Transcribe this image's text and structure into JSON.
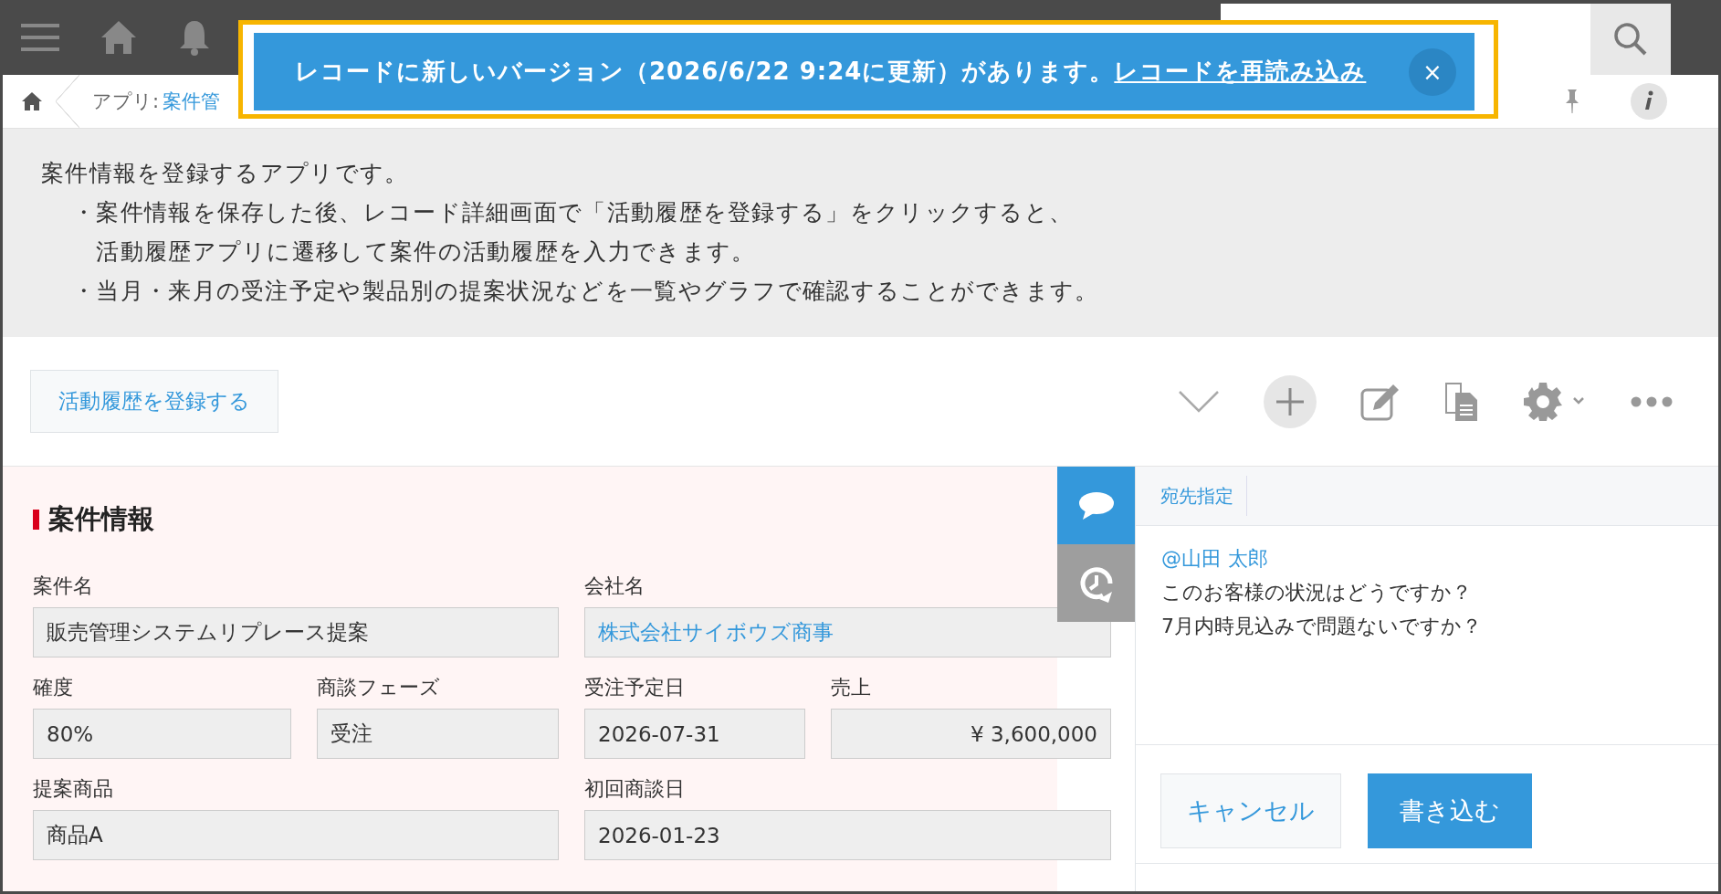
{
  "breadcrumb": {
    "prefix": "アプリ:",
    "app": "案件管"
  },
  "notice": {
    "message": "レコードに新しいバージョン（2026/6/22 9:24に更新）があります。",
    "link": "レコードを再読み込み",
    "close": "×"
  },
  "description": {
    "intro": "案件情報を登録するアプリです。",
    "bullets": [
      {
        "marker": "・",
        "lines": [
          "案件情報を保存した後、レコード詳細画面で「活動履歴を登録する」をクリックすると、",
          "活動履歴アプリに遷移して案件の活動履歴を入力できます。"
        ]
      },
      {
        "marker": "・",
        "lines": [
          "当月・来月の受注予定や製品別の提案状況などを一覧やグラフで確認することができます。"
        ]
      }
    ]
  },
  "actions": {
    "button": "活動履歴を登録する"
  },
  "form": {
    "section_title": "案件情報",
    "fields": [
      {
        "label": "案件名",
        "value": "販売管理システムリプレース提案",
        "kind": "text",
        "wide": true
      },
      {
        "label": "会社名",
        "value": "株式会社サイボウズ商事",
        "kind": "link",
        "wide": true
      },
      {
        "label": "確度",
        "value": "80%",
        "kind": "text",
        "wide": false
      },
      {
        "label": "商談フェーズ",
        "value": "受注",
        "kind": "text",
        "wide": false
      },
      {
        "label": "受注予定日",
        "value": "2026-07-31",
        "kind": "text",
        "wide": false
      },
      {
        "label": "売上",
        "value": "¥ 3,600,000",
        "kind": "currency",
        "wide": false
      },
      {
        "label": "提案商品",
        "value": "商品A",
        "kind": "text",
        "wide": true
      },
      {
        "label": "初回商談日",
        "value": "2026-01-23",
        "kind": "text",
        "wide": true
      }
    ]
  },
  "side_tabs": [
    {
      "kind": "comments",
      "selected": true
    },
    {
      "kind": "history",
      "selected": false
    }
  ],
  "comment": {
    "mention_tab": "宛先指定",
    "mention": "@山田 太郎",
    "lines": [
      "このお客様の状況はどうですか？",
      "7月内時見込みで問題ないですか？"
    ],
    "cancel": "キャンセル",
    "submit": "書き込む"
  }
}
